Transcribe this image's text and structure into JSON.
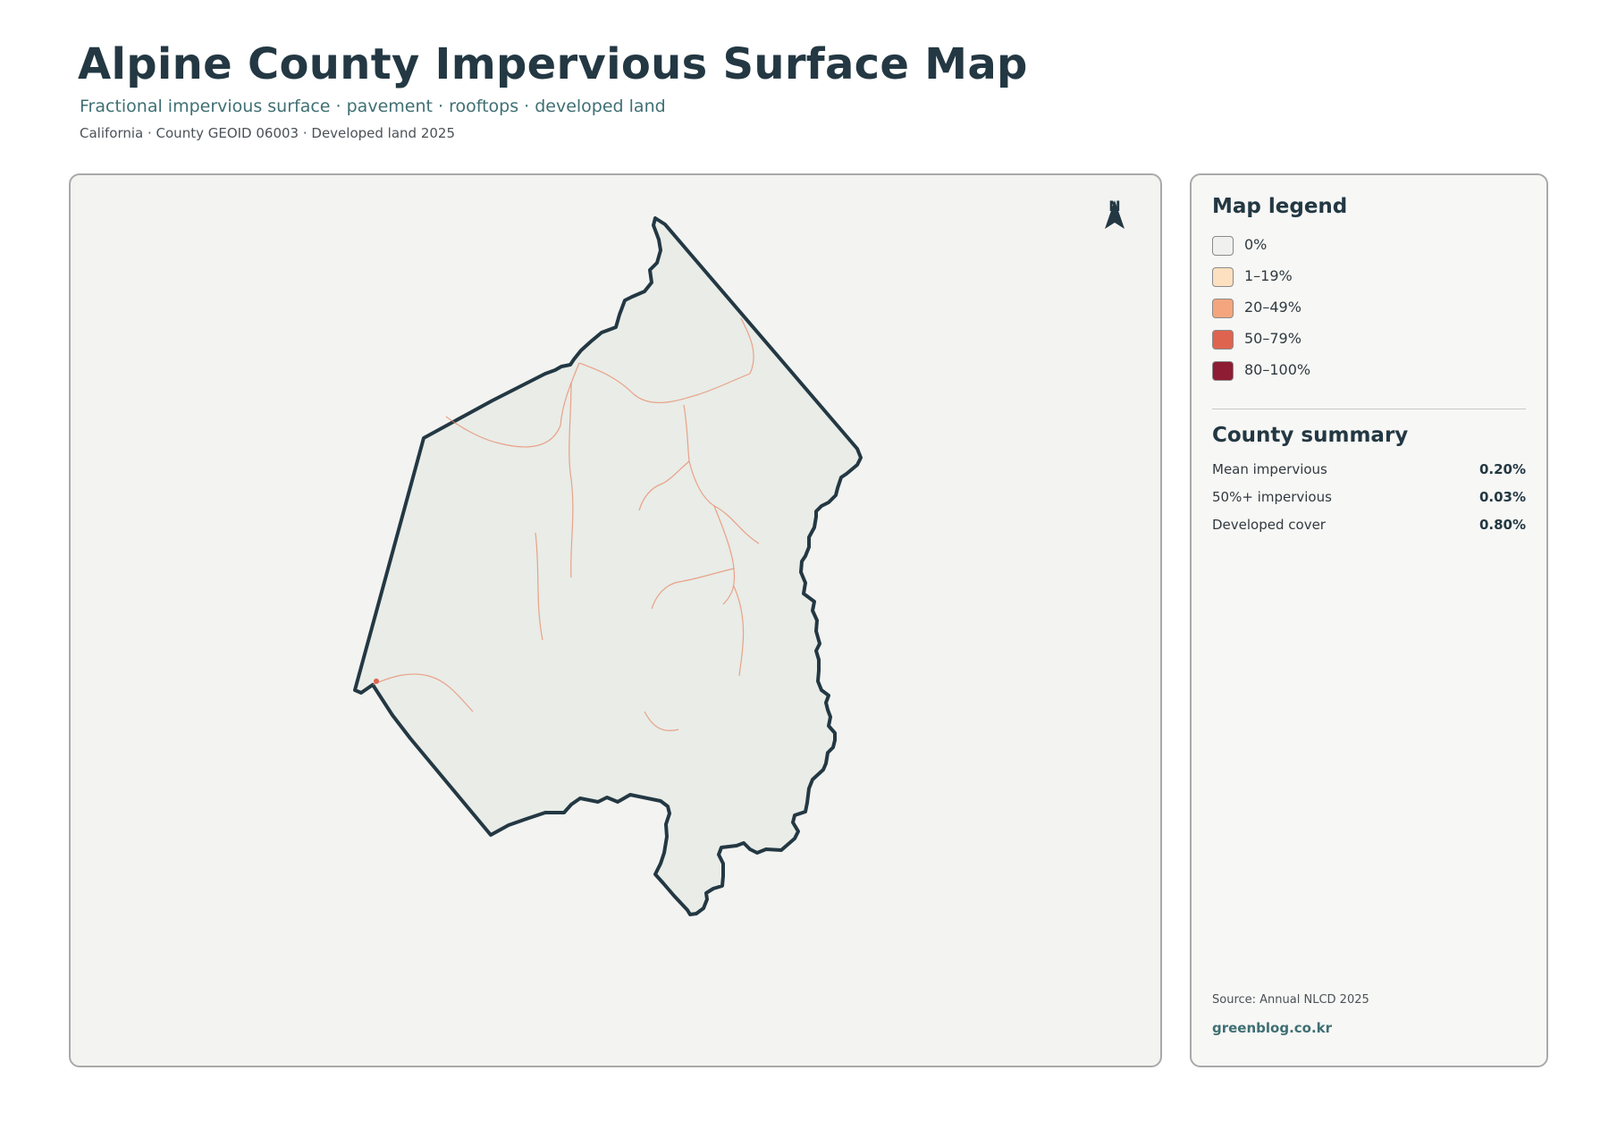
{
  "header": {
    "title": "Alpine County Impervious Surface Map",
    "subtitle": "Fractional impervious surface · pavement · rooftops · developed land",
    "meta": "California · County GEOID 06003 · Developed land 2025"
  },
  "map": {
    "north_label": "N",
    "county_fill": "#e9ece7",
    "county_outline": "#233843",
    "road_color": "#e8825f"
  },
  "legend": {
    "title": "Map legend",
    "items": [
      {
        "label": "0%",
        "color": "#f0f0ee"
      },
      {
        "label": "1–19%",
        "color": "#fde0c0"
      },
      {
        "label": "20–49%",
        "color": "#f4a57d"
      },
      {
        "label": "50–79%",
        "color": "#de6450"
      },
      {
        "label": "80–100%",
        "color": "#8e1c33"
      }
    ]
  },
  "summary": {
    "title": "County summary",
    "rows": [
      {
        "label": "Mean impervious",
        "value": "0.20%"
      },
      {
        "label": "50%+ impervious",
        "value": "0.03%"
      },
      {
        "label": "Developed cover",
        "value": "0.80%"
      }
    ]
  },
  "footer": {
    "source": "Source: Annual NLCD 2025",
    "site": "greenblog.co.kr"
  }
}
